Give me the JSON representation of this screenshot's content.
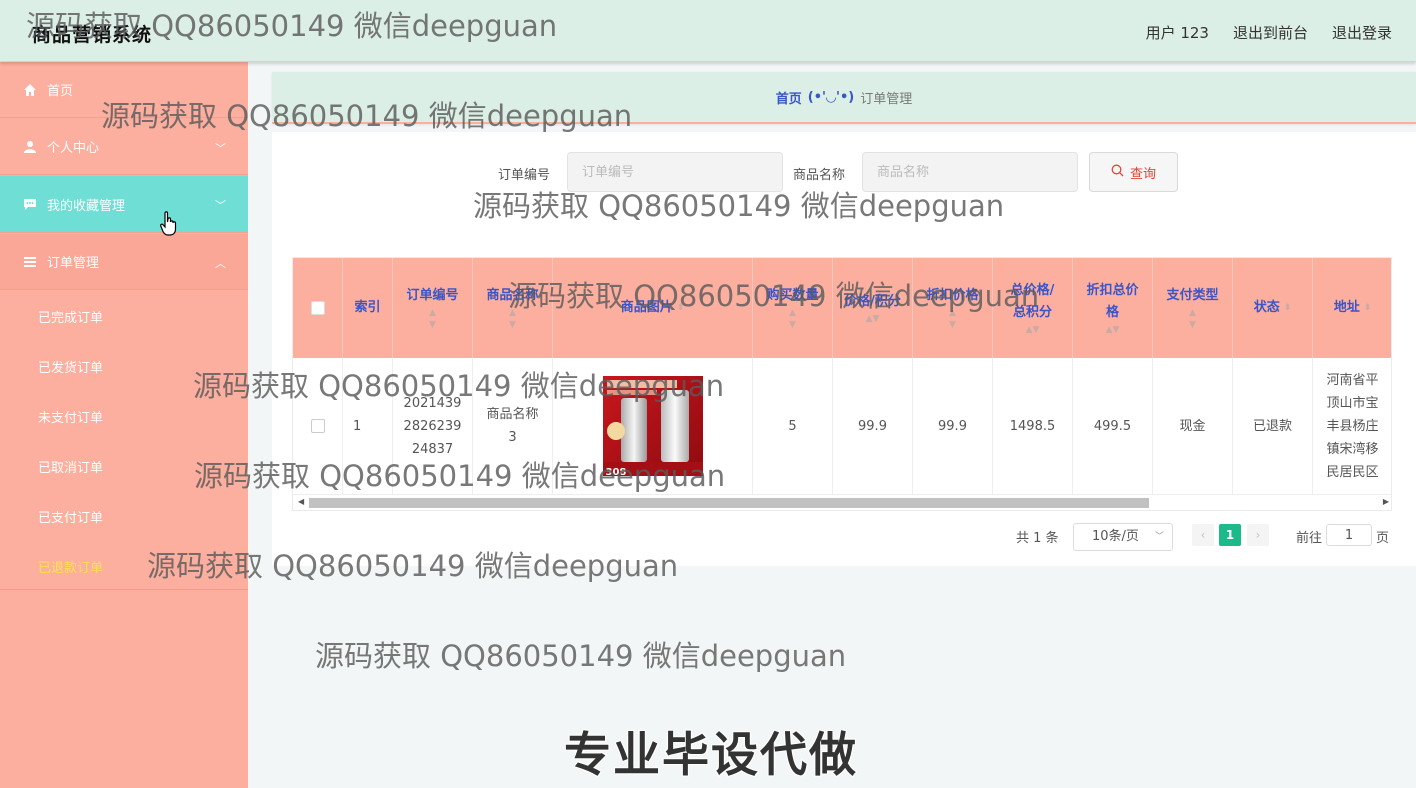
{
  "header": {
    "app_title": "商品营销系统",
    "user_label": "用户 123",
    "exit_frontend": "退出到前台",
    "logout": "退出登录"
  },
  "sidebar": {
    "items": [
      {
        "label": "首页",
        "icon": "home-icon"
      },
      {
        "label": "个人中心",
        "icon": "user-icon"
      },
      {
        "label": "我的收藏管理",
        "icon": "chat-icon"
      },
      {
        "label": "订单管理",
        "icon": "list-icon"
      }
    ],
    "order_submenu": [
      "已完成订单",
      "已发货订单",
      "未支付订单",
      "已取消订单",
      "已支付订单",
      "已退款订单"
    ]
  },
  "breadcrumb": {
    "home": "首页",
    "face": "(•'◡'•)",
    "current": "订单管理"
  },
  "search": {
    "order_no_label": "订单编号",
    "order_no_placeholder": "订单编号",
    "product_name_label": "商品名称",
    "product_name_placeholder": "商品名称",
    "query_button": "查询"
  },
  "table": {
    "columns": [
      "索引",
      "订单编号",
      "商品名称",
      "商品图片",
      "购买数量",
      "价格/积分",
      "折扣价格",
      "总价格/总积分",
      "折扣总价格",
      "支付类型",
      "状态",
      "地址"
    ],
    "rows": [
      {
        "index": "1",
        "order_no": "20214392826239 24837",
        "order_no_lines": [
          "2021439",
          "2826239",
          "24837"
        ],
        "product_name_lines": [
          "商品名称",
          "3"
        ],
        "image_caption": "308",
        "quantity": "5",
        "price": "99.9",
        "discount_price": "99.9",
        "total_price": "1498.5",
        "discount_total": "499.5",
        "pay_type": "现金",
        "status": "已退款",
        "address_lines": [
          "河南省平",
          "顶山市宝",
          "丰县杨庄",
          "镇宋湾移",
          "民居民区"
        ]
      }
    ]
  },
  "pagination": {
    "total": "共 1 条",
    "page_size": "10条/页",
    "current_page": "1",
    "goto_label": "前往",
    "goto_value": "1",
    "page_suffix": "页"
  },
  "watermarks": {
    "text": "源码获取 QQ86050149 微信deepguan",
    "banner": "专业毕设代做"
  },
  "colors": {
    "sidebar_bg": "#fdaf9f",
    "active_menu": "#6fdfd6",
    "header_bg": "#dcefe6",
    "accent_blue": "#3a55c8",
    "page_active": "#1aba8a",
    "current_submenu": "#ffe34d"
  }
}
